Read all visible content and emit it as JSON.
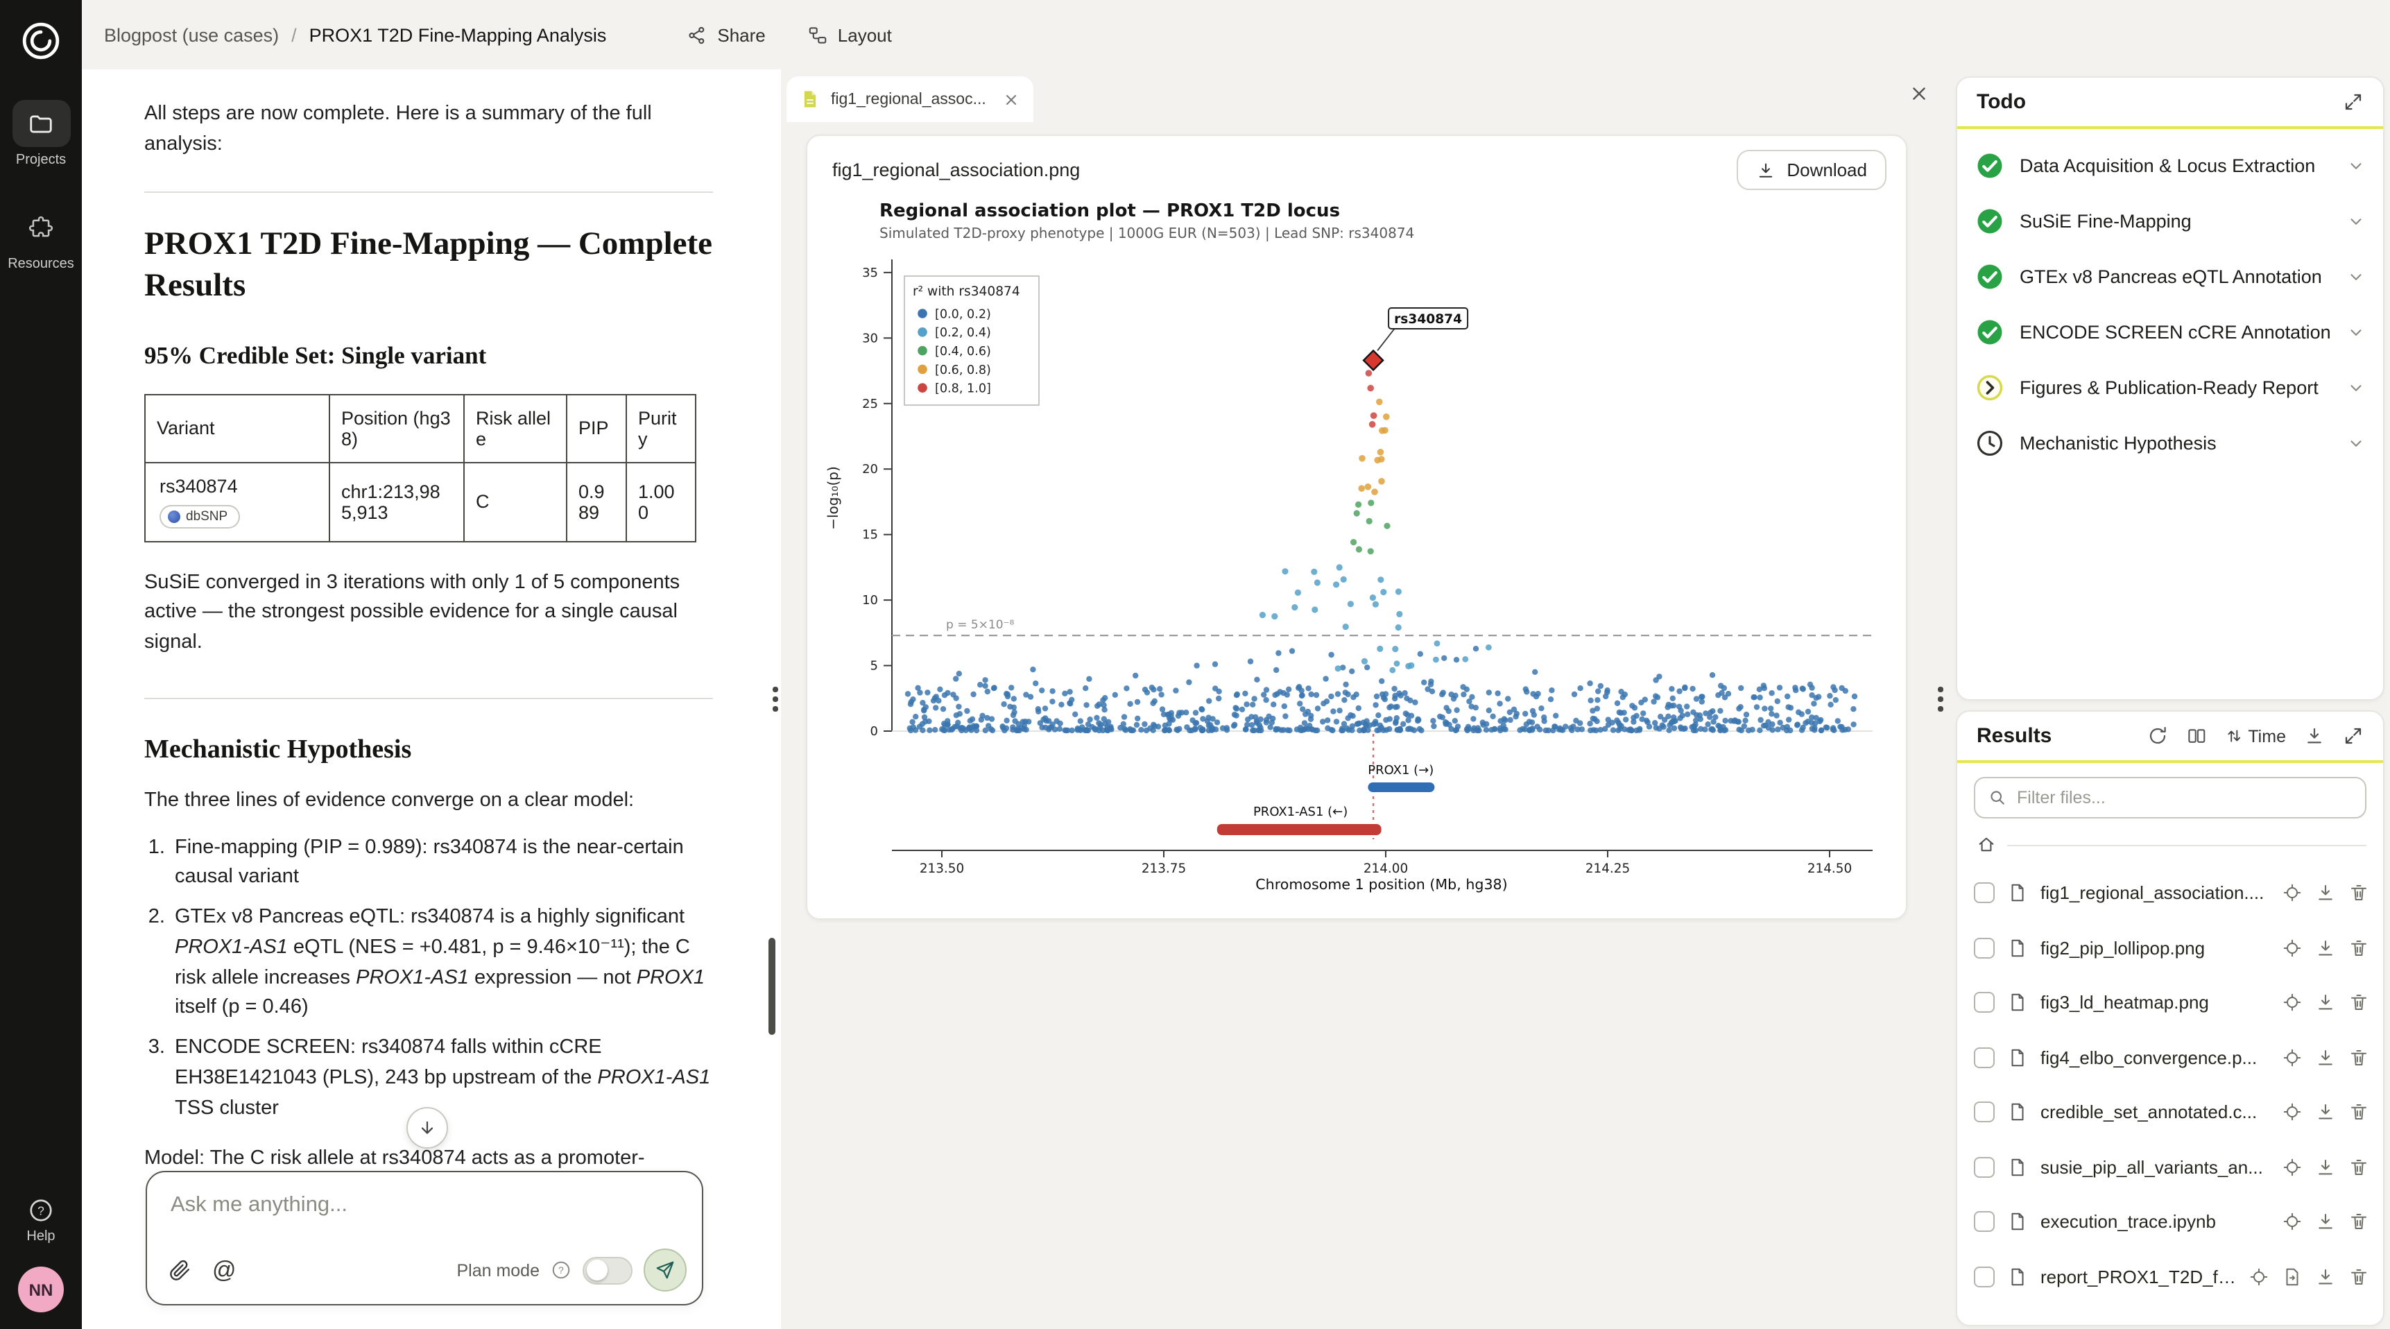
{
  "app": {
    "breadcrumb": {
      "section": "Blogpost (use cases)",
      "separator": "/",
      "page": "PROX1 T2D Fine-Mapping Analysis"
    },
    "header_actions": {
      "share": "Share",
      "layout": "Layout"
    }
  },
  "sidebar": {
    "items": [
      {
        "label": "Projects"
      },
      {
        "label": "Resources"
      }
    ],
    "help_label": "Help",
    "avatar_initials": "NN"
  },
  "chat": {
    "intro": "All steps are now complete. Here is a summary of the full analysis:",
    "title": "PROX1 T2D Fine-Mapping — Complete Results",
    "subtitle": "95% Credible Set: Single variant",
    "table": {
      "headers": [
        "Variant",
        "Position (hg38)",
        "Risk allele",
        "PIP",
        "Purity"
      ],
      "row": {
        "variant": "rs340874",
        "badge": "dbSNP",
        "position": "chr1:213,985,913",
        "risk_allele": "C",
        "pip": "0.989",
        "purity": "1.000"
      }
    },
    "susie_note": "SuSiE converged in 3 iterations with only 1 of 5 components active — the strongest possible evidence for a single causal signal.",
    "hypothesis_title": "Mechanistic Hypothesis",
    "hypothesis_intro": "The three lines of evidence converge on a clear model:",
    "list": [
      {
        "segments": [
          {
            "t": "Fine-mapping (PIP = 0.989): rs340874 is the near-certain causal variant"
          }
        ]
      },
      {
        "segments": [
          {
            "t": "GTEx v8 Pancreas eQTL: rs340874 is a highly significant "
          },
          {
            "t": "PROX1-AS1",
            "i": true
          },
          {
            "t": " eQTL (NES = +0.481, p = 9.46×10⁻¹¹); the C risk allele increases "
          },
          {
            "t": "PROX1-AS1",
            "i": true
          },
          {
            "t": " expression — not "
          },
          {
            "t": "PROX1",
            "i": true
          },
          {
            "t": " itself (p = 0.46)"
          }
        ]
      },
      {
        "segments": [
          {
            "t": "ENCODE SCREEN: rs340874 falls within cCRE EH38E1421043 (PLS), 243 bp upstream of the "
          },
          {
            "t": "PROX1-AS1",
            "i": true
          },
          {
            "t": " TSS cluster"
          }
        ]
      }
    ],
    "model_text": "Model: The C risk allele at rs340874 acts as a promoter-",
    "input": {
      "placeholder": "Ask me anything...",
      "plan_mode_label": "Plan mode"
    }
  },
  "viewer": {
    "tab_label": "fig1_regional_assoc...",
    "file_title": "fig1_regional_association.png",
    "download_label": "Download"
  },
  "todo": {
    "title": "Todo",
    "items": [
      {
        "label": "Data Acquisition & Locus Extraction",
        "status": "done"
      },
      {
        "label": "SuSiE Fine-Mapping",
        "status": "done"
      },
      {
        "label": "GTEx v8 Pancreas eQTL Annotation",
        "status": "done"
      },
      {
        "label": "ENCODE SCREEN cCRE Annotation",
        "status": "done"
      },
      {
        "label": "Figures & Publication-Ready Report",
        "status": "in_progress"
      },
      {
        "label": "Mechanistic Hypothesis",
        "status": "pending"
      }
    ]
  },
  "results": {
    "title": "Results",
    "sort_label": "Time",
    "filter_placeholder": "Filter files...",
    "files": [
      {
        "name": "fig1_regional_association...."
      },
      {
        "name": "fig2_pip_lollipop.png"
      },
      {
        "name": "fig3_ld_heatmap.png"
      },
      {
        "name": "fig4_elbo_convergence.p..."
      },
      {
        "name": "credible_set_annotated.c..."
      },
      {
        "name": "susie_pip_all_variants_an..."
      },
      {
        "name": "execution_trace.ipynb"
      },
      {
        "name": "report_PROX1_T2D_fi...",
        "extra": true
      }
    ]
  },
  "colors": {
    "accent_yellow": "#e3e74c",
    "done_green": "#28a245",
    "avatar_pink": "#f2a9c4",
    "gene_blue": "#2f6db5",
    "gene_red": "#c23b34"
  },
  "chart_data": {
    "type": "scatter",
    "title": "Regional association plot — PROX1 T2D locus",
    "subtitle": "Simulated T2D-proxy phenotype | 1000G EUR (N=503) | Lead SNP: rs340874",
    "xlabel": "Chromosome 1 position (Mb, hg38)",
    "ylabel": "−log₁₀(p)",
    "xlim": [
      213.44,
      214.55
    ],
    "ylim": [
      0,
      36
    ],
    "xticks": [
      213.5,
      213.75,
      214.0,
      214.25,
      214.5
    ],
    "yticks": [
      0,
      5,
      10,
      15,
      20,
      25,
      30,
      35
    ],
    "grid": false,
    "threshold": {
      "y": 7.3,
      "label": "p = 5×10⁻⁸"
    },
    "legend": {
      "title": "r² with rs340874",
      "position": "upper-left",
      "bins": [
        {
          "label": "[0.0, 0.2)",
          "color": "#3b75af"
        },
        {
          "label": "[0.2, 0.4)",
          "color": "#55a1c9"
        },
        {
          "label": "[0.4, 0.6)",
          "color": "#4fa362"
        },
        {
          "label": "[0.6, 0.8)",
          "color": "#dfa13d"
        },
        {
          "label": "[0.8, 1.0]",
          "color": "#cc4540"
        }
      ]
    },
    "lead_snp": {
      "id": "rs340874",
      "x": 213.986,
      "y": 28.3,
      "marker": "diamond",
      "color": "#d6372e"
    },
    "genes": [
      {
        "name": "PROX1 (→)",
        "start": 213.98,
        "end": 214.055,
        "label_x": 214.017,
        "color": "#2f6db5",
        "row": 0
      },
      {
        "name": "PROX1-AS1 (←)",
        "start": 213.81,
        "end": 213.995,
        "label_x": 213.904,
        "color": "#c23b34",
        "row": 1
      }
    ],
    "points": {
      "seed": 20,
      "background_clusters": [
        {
          "n": 760,
          "x": [
            213.46,
            214.53
          ],
          "y": [
            0.05,
            3.4
          ],
          "dist": "floor",
          "color": "#3b75af",
          "r": 2.1
        },
        {
          "n": 70,
          "x": [
            213.47,
            214.52
          ],
          "y": [
            2.8,
            5.4
          ],
          "dist": "floor",
          "color": "#3b75af",
          "r": 2.1
        },
        {
          "n": 10,
          "x": [
            213.8,
            214.2
          ],
          "y": [
            4.8,
            6.6
          ],
          "dist": "uniform",
          "color": "#3b75af",
          "r": 2.1
        },
        {
          "n": 20,
          "x": [
            213.92,
            214.03
          ],
          "y": [
            4.2,
            12.6
          ],
          "dist": "uniform",
          "color": "#55a1c9",
          "r": 2.3
        },
        {
          "n": 6,
          "x": [
            213.86,
            213.92
          ],
          "y": [
            8.6,
            12.4
          ],
          "dist": "uniform",
          "color": "#55a1c9",
          "r": 2.3
        },
        {
          "n": 6,
          "x": [
            214.0,
            214.13
          ],
          "y": [
            4.4,
            6.8
          ],
          "dist": "uniform",
          "color": "#55a1c9",
          "r": 2.2
        },
        {
          "n": 8,
          "x": [
            213.958,
            214.005
          ],
          "y": [
            13.5,
            17.8
          ],
          "dist": "uniform",
          "color": "#4fa362",
          "r": 2.3
        },
        {
          "n": 12,
          "x": [
            213.972,
            214.002
          ],
          "y": [
            17.5,
            25.3
          ],
          "dist": "uniform",
          "color": "#dfa13d",
          "r": 2.4
        },
        {
          "n": 4,
          "x": [
            213.98,
            213.996
          ],
          "y": [
            21.5,
            27.4
          ],
          "dist": "uniform",
          "color": "#cc4540",
          "r": 2.4
        }
      ]
    }
  }
}
